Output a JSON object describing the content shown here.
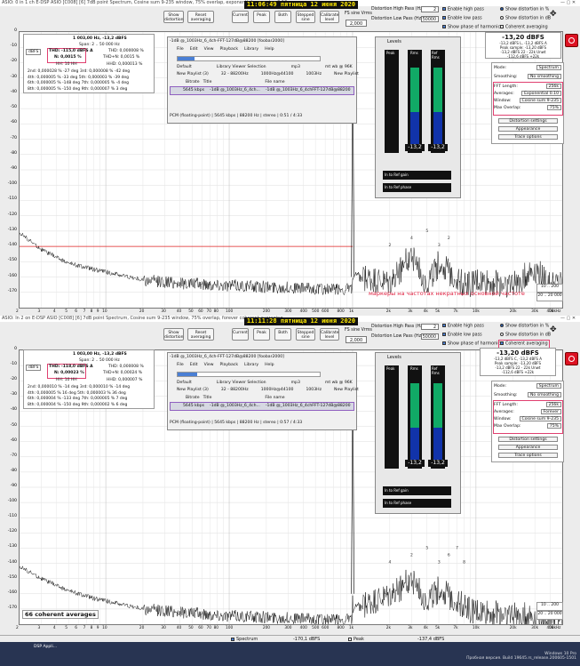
{
  "top": {
    "title": "ASIO: 0 in 1 ch E-DSP ASIO [C008] [6] 7dB point Spectrum, Cosine sum 9-235 window, 75% overlap, exponential averaging 0.10",
    "clock": "11:06:49",
    "date": "пятница 12 июня 2020",
    "buttons": {
      "show_distortion": "Show distortion",
      "reset_averaging": "Reset averaging",
      "current": "Current",
      "peak": "Peak",
      "both": "Both",
      "stepped_sine": "Stepped sine",
      "calibrate": "Calibrate level"
    },
    "fs": {
      "label": "FS sine Vrms",
      "value": "2,000"
    },
    "hp": {
      "label": "Distortion High Pass (Hz):",
      "value": "2"
    },
    "lp": {
      "label": "Distortion Low Pass (Hz):",
      "value": "50000"
    },
    "checks": [
      "Enable high pass",
      "Enable low pass",
      "Show phase of harmonics"
    ],
    "radios": [
      "Show distortion in %",
      "Show distortion in dB",
      "Coherent averaging"
    ],
    "level": {
      "value": "-13,20 dBFS",
      "lines": [
        "-13,2 dBFS L, -13,2 dBFS A",
        "Peak sample: -13,20 dBFS",
        "-13,2 dBFS 22 - 22k Unwt",
        "-112,6 dBFS +22k"
      ]
    },
    "settings": {
      "mode_label": "Mode:",
      "mode": "Spectrum",
      "smoothing_label": "Smoothing:",
      "smoothing": "No smoothing",
      "fft_label": "FFT Length:",
      "fft": "256k",
      "avg_label": "Averages:",
      "avg": "Exponential 0.10",
      "window_label": "Window:",
      "window": "Cosine sum 9-235",
      "overlap_label": "Max Overlap:",
      "overlap": "75%",
      "b1": "Distortion settings",
      "b2": "Appearance",
      "b3": "Trace options"
    },
    "thd": {
      "header1": "1 003,00 Hz, -13,2 dBFS",
      "header2": "Span: 2 .. 50 000 Hz",
      "unit": "dBFS",
      "thd_row": "THD: -115,0 dBFS A",
      "thd_pct": "THD: 0,000008 %",
      "n_pct": "N: 0,0015 %",
      "thdn_pct": "THD+N: 0,0015 %",
      "h": "HH: 10 HH",
      "hhd_pct": "HHD: 0,000013 %",
      "rows": [
        [
          "2nd:",
          "0,000028 %",
          "-27 deg",
          "3rd:",
          "0,000008 %",
          "-42 deg"
        ],
        [
          "4th:",
          "0,000005 %",
          "-33 deg",
          "5th:",
          "0,000003 %",
          "-39 deg"
        ],
        [
          "6th:",
          "0,000005 %",
          "-148 deg",
          "7th:",
          "0,000005 %",
          "-4 deg"
        ],
        [
          "8th:",
          "0,000005 %",
          "-150 deg",
          "9th:",
          "0,000007 %",
          "3 deg"
        ]
      ]
    },
    "player": {
      "title": "-1dB @_1003Hz_6_4ch-FFT-127dB@88200 [foobar2000]",
      "menu": [
        "File",
        "Edit",
        "View",
        "Playback",
        "Library",
        "Help"
      ],
      "cols": [
        "Default",
        "Library Viewer Selection",
        "mp3",
        "mt wb @ 96K"
      ],
      "row2": [
        "New Playlist (3)",
        "32 - 88200Hz",
        "1000Hz@44100",
        "1003Hz",
        "New Playlist"
      ],
      "head": [
        "Bitrate",
        "Title",
        "File name"
      ],
      "track": [
        "5645 kbps",
        "-1dB @_1003Hz_6_4ch...",
        "-1dB @_1003Hz_6_4chFFT-127dB@88200"
      ],
      "status": "PCM (floating-point) | 5645 kbps | 88200 Hz | stereo | 0:51 / 4:33"
    },
    "levels": {
      "title": "Levels",
      "labels": [
        "Peak",
        "Rms",
        "Ref Rms"
      ],
      "vals": [
        "-13,2",
        "-13,2"
      ],
      "in_ref_gain": "In to Ref gain",
      "in_ref_phase": "In to Ref phase"
    },
    "annotation": "маркеры на частотах некратных основной частоте",
    "range": [
      "10 .. 200",
      "20 .. 20 000"
    ],
    "markers": [
      "2",
      "4",
      "5",
      "3",
      "2"
    ]
  },
  "bottom": {
    "title": "ASIO: In 2 on E-DSP ASIO [C008] [6] 7dB point Spectrum, Cosine sum 9-235 window, 75% overlap, forever coherent averaging",
    "clock": "11:11:28",
    "date": "пятница 12 июня 2020",
    "level": {
      "value": "-13,20 dBFS",
      "lines": [
        "-13,2 dBFS C, -13,2 dBFS A",
        "Peak sample: -13,20 dBFS",
        "-13,2 dBFS 22 - 22k Unwt",
        "-112,6 dBFS +22k"
      ]
    },
    "settings": {
      "fft": "256k",
      "avg": "Forever",
      "window": "Cosine sum 9-235",
      "overlap": "75%"
    },
    "thd": {
      "header1": "1 003,00 Hz, -13,2 dBFS",
      "header2": "Span: 2 .. 50 000 Hz",
      "thd_row": "THD: -118,0 dBFS A",
      "thd_pct": "THD: 0,000008 %",
      "n_pct": "N: 0,00023 %",
      "thdn_pct": "THD+N: 0,00024 %",
      "h": "HH: 10 HH",
      "hhd_pct": "HHD: 0,000007 %",
      "rows": [
        [
          "2nd:",
          "0,000010 %",
          "-14 deg",
          "3rd:",
          "0,000010 %",
          "-14 deg"
        ],
        [
          "4th:",
          "0,000005 %",
          "16 deg",
          "5th:",
          "0,000003 %",
          "36 deg"
        ],
        [
          "6th:",
          "0,000004 %",
          "-133 deg",
          "7th:",
          "0,000005 %",
          "7 deg"
        ],
        [
          "8th:",
          "0,000004 %",
          "-150 deg",
          "9th:",
          "0,000002 %",
          "6 deg"
        ]
      ]
    },
    "player": {
      "track": [
        "5645 kbps",
        "-1dB @_1003Hz_6_4ch...",
        "-1dB @_1003Hz_6_4chFFT-127dB@88200"
      ],
      "status": "PCM (floating-point) | 5645 kbps | 88200 Hz | stereo | 0:57 / 4:33"
    },
    "avg_note": "66 coherent averages",
    "range": [
      "10 .. 200",
      "20 .. 20 000"
    ],
    "markers": [
      "4",
      "2",
      "5",
      "3",
      "6",
      "7",
      "8"
    ]
  },
  "yticks": [
    "0",
    "-10",
    "-20",
    "-30",
    "-40",
    "-50",
    "-60",
    "-70",
    "-80",
    "-90",
    "-100",
    "-110",
    "-120",
    "-130",
    "-140",
    "-150",
    "-160",
    "-170"
  ],
  "xticks": [
    "2",
    "3",
    "4",
    "5",
    "6",
    "7",
    "8",
    "9",
    "10",
    "20",
    "30",
    "40",
    "50",
    "60",
    "70",
    "80",
    "100",
    "200",
    "300",
    "400",
    "500",
    "600",
    "800",
    "1k",
    "2k",
    "3k",
    "4k",
    "5k",
    "7k",
    "10k",
    "20k",
    "30k",
    "40k",
    "50kHz"
  ],
  "status": {
    "l1": "Spectrum",
    "v1": "-170,1 dBFS",
    "l2": "Peak",
    "v2": "-137,4 dBFS"
  },
  "taskbar": {
    "os": "Windows 10 Pro",
    "build": "Пробная версия. Build 19645.rs_release.200605-1501",
    "app": "DSP Appli..."
  },
  "chart_data": [
    {
      "type": "line",
      "title": "",
      "xlabel": "Hz",
      "ylabel": "dBFS",
      "x_scale": "log",
      "xlim": [
        2,
        50000
      ],
      "ylim": [
        -180,
        0
      ],
      "grid": true,
      "series": [
        {
          "x": [
            2,
            3,
            5,
            8,
            12,
            20,
            40,
            80,
            150,
            300,
            600,
            1000,
            1003,
            1010,
            2000,
            3000,
            4000,
            5000,
            8000,
            10000,
            20000,
            30000,
            40000,
            50000
          ],
          "values": [
            -131,
            -142,
            -151,
            -155,
            -158,
            -162,
            -164,
            -165,
            -166,
            -167,
            -168,
            -168,
            -13.2,
            -160,
            -165,
            -145,
            -165,
            -151,
            -165,
            -163,
            -165,
            -155,
            -165,
            -165
          ]
        }
      ]
    },
    {
      "type": "line",
      "title": "",
      "xlabel": "Hz",
      "ylabel": "dBFS",
      "x_scale": "log",
      "xlim": [
        2,
        50000
      ],
      "ylim": [
        -180,
        0
      ],
      "grid": true,
      "series": [
        {
          "x": [
            2,
            3,
            5,
            8,
            12,
            20,
            40,
            80,
            150,
            300,
            600,
            1000,
            1003,
            1010,
            2000,
            3000,
            4000,
            5000,
            8000,
            10000,
            20000,
            30000,
            40000,
            50000
          ],
          "values": [
            -142,
            -150,
            -158,
            -163,
            -166,
            -170,
            -172,
            -174,
            -175,
            -176,
            -177,
            -177,
            -13.2,
            -171,
            -162,
            -150,
            -165,
            -157,
            -168,
            -172,
            -174,
            -175,
            -176,
            -176
          ]
        }
      ]
    }
  ]
}
